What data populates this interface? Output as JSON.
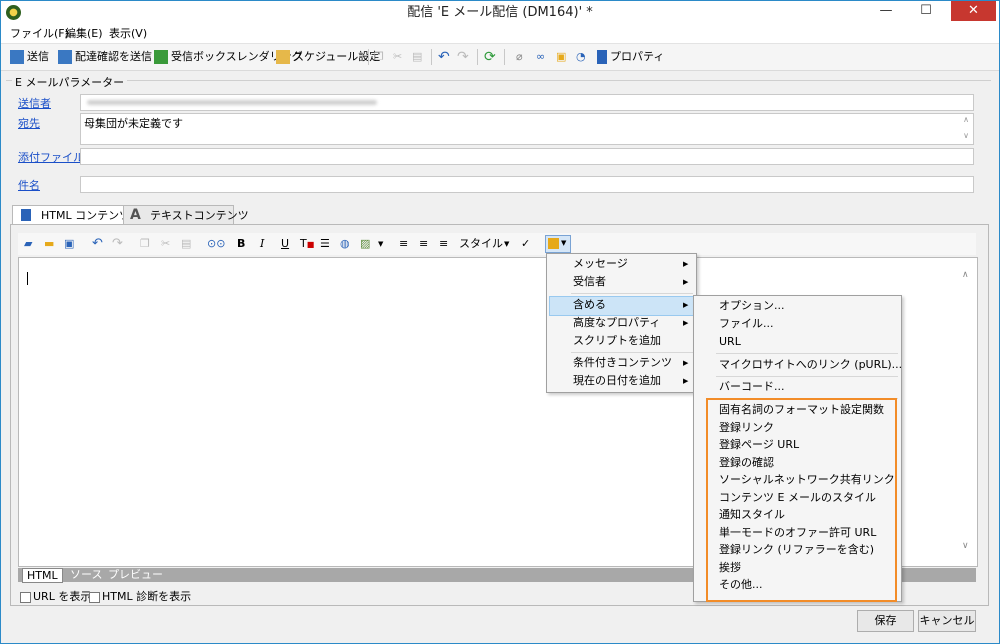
{
  "window": {
    "title": "配信 'E メール配信 (DM164)' *"
  },
  "menubar": [
    "ファイル(F)",
    "編集(E)",
    "表示(V)"
  ],
  "toolbar": {
    "send": "送信",
    "send_confirm": "配達確認を送信",
    "inbox_render": "受信ボックスレンダリング",
    "schedule": "スケジュール設定",
    "properties": "プロパティ"
  },
  "params": {
    "title": "E メールパラメーター",
    "from_label": "送信者",
    "to_label": "宛先",
    "to_value": "母集団が未定義です",
    "attach_label": "添付ファイル",
    "subject_label": "件名"
  },
  "tabs": {
    "html": "HTML コンテンツ",
    "text": "テキストコンテンツ"
  },
  "editor_toolbar": {
    "style": "スタイル"
  },
  "bottom_tabs": [
    "HTML",
    "ソース",
    "プレビュー"
  ],
  "checkboxes": {
    "show_url": "URL を表示",
    "html_diag": "HTML 診断を表示"
  },
  "footer": {
    "save": "保存",
    "cancel": "キャンセル"
  },
  "menu1": [
    "メッセージ",
    "受信者",
    "含める",
    "高度なプロパティ",
    "スクリプトを追加",
    "条件付きコンテンツ",
    "現在の日付を追加"
  ],
  "menu2": [
    "オプション...",
    "ファイル...",
    "URL",
    "マイクロサイトへのリンク (pURL)...",
    "バーコード...",
    "固有名詞のフォーマット設定関数",
    "登録リンク",
    "登録ページ URL",
    "登録の確認",
    "ソーシャルネットワーク共有リンク",
    "コンテンツ E メールのスタイル",
    "通知スタイル",
    "単一モードのオファー許可 URL",
    "登録リンク (リファラーを含む)",
    "挨拶",
    "その他..."
  ],
  "colors": {
    "accent": "#2b8ac8",
    "highlight": "#f28c28",
    "close": "#c7372f",
    "link": "#1a4fc8"
  }
}
